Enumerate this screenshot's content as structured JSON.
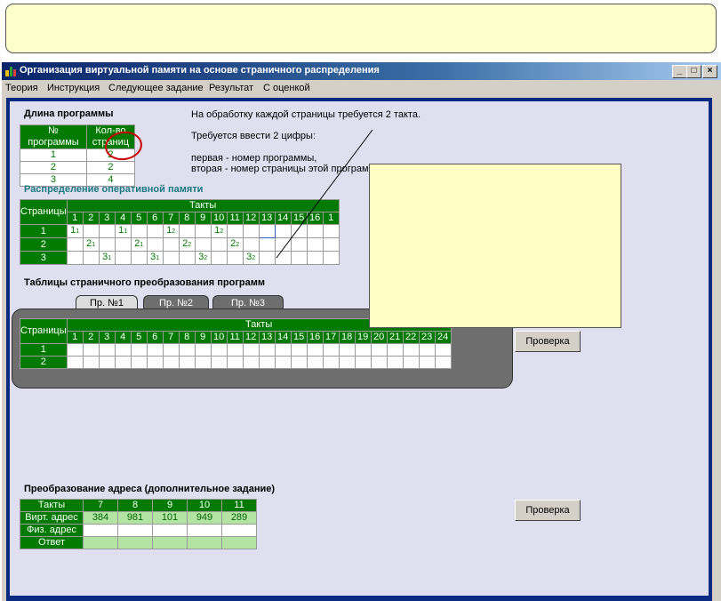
{
  "window": {
    "title": "Организация виртуальной памяти на основе страничного распределения"
  },
  "menu": [
    "Теория",
    "Инструкция",
    "Следующее задание",
    "Результат",
    "С оценкой"
  ],
  "program_length": {
    "heading": "Длина программы",
    "col1": [
      "№",
      "программы"
    ],
    "col2": [
      "Кол-во",
      "страниц"
    ],
    "rows": [
      [
        "1",
        "2"
      ],
      [
        "2",
        "2"
      ],
      [
        "3",
        "4"
      ]
    ]
  },
  "info": {
    "line1": "На обработку каждой страницы требуется 2 такта.",
    "line2": "Требуется ввести 2 цифры:",
    "line3": "первая - номер программы,",
    "line4": "вторая - номер страницы этой программы"
  },
  "ram": {
    "heading": "Распределение оперативной памяти",
    "row_header": "Страницы",
    "tact_header": "Такты",
    "tacts": [
      "1",
      "2",
      "3",
      "4",
      "5",
      "6",
      "7",
      "8",
      "9",
      "10",
      "11",
      "12",
      "13",
      "14",
      "15",
      "16",
      "1"
    ],
    "rows": [
      {
        "label": "1",
        "cells": [
          [
            "1",
            "1"
          ],
          null,
          null,
          [
            "1",
            "1"
          ],
          null,
          null,
          [
            "1",
            "2"
          ],
          null,
          null,
          [
            "1",
            "2"
          ],
          null,
          null,
          null,
          null,
          null,
          null,
          null
        ]
      },
      {
        "label": "2",
        "cells": [
          null,
          [
            "2",
            "1"
          ],
          null,
          null,
          [
            "2",
            "1"
          ],
          null,
          null,
          [
            "2",
            "2"
          ],
          null,
          null,
          [
            "2",
            "2"
          ],
          null,
          null,
          null,
          null,
          null,
          null
        ]
      },
      {
        "label": "3",
        "cells": [
          null,
          null,
          [
            "3",
            "1"
          ],
          null,
          null,
          [
            "3",
            "1"
          ],
          null,
          null,
          [
            "3",
            "2"
          ],
          null,
          null,
          [
            "3",
            "2"
          ],
          null,
          null,
          null,
          null,
          null
        ]
      }
    ]
  },
  "page_tables": {
    "heading": "Таблицы страничного преобразования программ",
    "tabs": [
      "Пр. №1",
      "Пр. №2",
      "Пр. №3"
    ],
    "row_header": "Страницы",
    "tact_header": "Такты",
    "tacts": [
      "1",
      "2",
      "3",
      "4",
      "5",
      "6",
      "7",
      "8",
      "9",
      "10",
      "11",
      "12",
      "13",
      "14",
      "15",
      "16",
      "17",
      "18",
      "19",
      "20",
      "21",
      "22",
      "23",
      "24"
    ],
    "rows": [
      "1",
      "2"
    ],
    "check_button": "Проверка"
  },
  "address": {
    "heading": "Преобразование адреса (дополнительное задание)",
    "header_label": "Такты",
    "tacts": [
      "7",
      "8",
      "9",
      "10",
      "11"
    ],
    "virt_label": "Вирт. адрес",
    "virt": [
      "384",
      "981",
      "101",
      "949",
      "289"
    ],
    "phys_label": "Физ. адрес",
    "answer_label": "Ответ",
    "check_button": "Проверка"
  },
  "colors": {
    "accent": "#007a00",
    "frame": "#0a2a80",
    "popup": "#ffffc4",
    "annotation": "#cc0000"
  }
}
